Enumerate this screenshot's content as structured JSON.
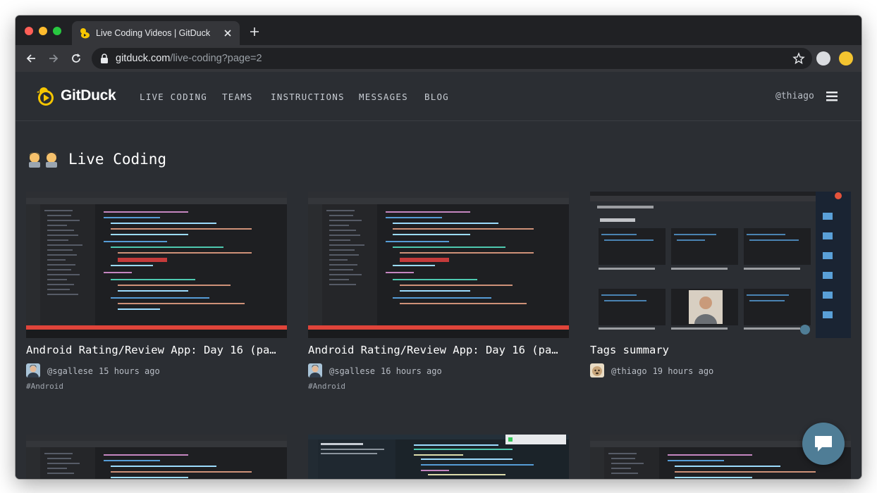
{
  "browser": {
    "tab_title": "Live Coding Videos | GitDuck",
    "url_host": "gitduck.com",
    "url_path": "/live-coding?page=2"
  },
  "site": {
    "logo": "GitDuck",
    "nav": [
      "LIVE CODING",
      "TEAMS",
      "INSTRUCTIONS",
      "MESSAGES",
      "BLOG"
    ],
    "username": "@thiago"
  },
  "page": {
    "title": "Live Coding"
  },
  "videos": [
    {
      "title": "Android Rating/Review App: Day 16 (pa…",
      "author": "@sgallese",
      "time": "15 hours ago",
      "tag": "#Android",
      "thumb": "code-editor"
    },
    {
      "title": "Android Rating/Review App: Day 16 (pa…",
      "author": "@sgallese",
      "time": "16 hours ago",
      "tag": "#Android",
      "thumb": "code-editor"
    },
    {
      "title": "Tags summary",
      "author": "@thiago",
      "time": "19 hours ago",
      "tag": "",
      "thumb": "gitduck-page"
    }
  ],
  "colors": {
    "page_bg": "#2b2e33",
    "accent_red": "#e0443a",
    "brand_yellow": "#f7c600",
    "chat_button": "#4f7d96"
  },
  "icons": [
    "back-icon",
    "forward-icon",
    "reload-icon",
    "lock-icon",
    "star-icon",
    "menu-icon",
    "chat-icon"
  ]
}
